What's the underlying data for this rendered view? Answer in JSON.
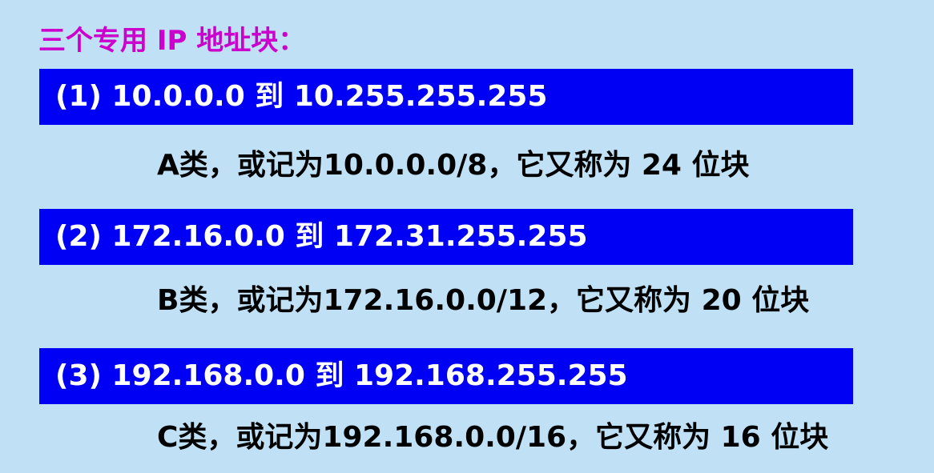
{
  "title": "三个专用 IP 地址块：",
  "blocks": [
    {
      "range": "(1) 10.0.0.0 到 10.255.255.255",
      "description": "A类，或记为10.0.0.0/8，它又称为 24 位块"
    },
    {
      "range": "(2) 172.16.0.0 到 172.31.255.255",
      "description": "B类，或记为172.16.0.0/12，它又称为 20 位块"
    },
    {
      "range": "(3) 192.168.0.0 到 192.168.255.255",
      "description": "C类，或记为192.168.0.0/16，它又称为 16 位块"
    }
  ],
  "colors": {
    "background": "#bfe0f5",
    "title": "#cc00cc",
    "bar": "#0000f4",
    "bar_text": "#ffffff",
    "description_text": "#000000"
  }
}
